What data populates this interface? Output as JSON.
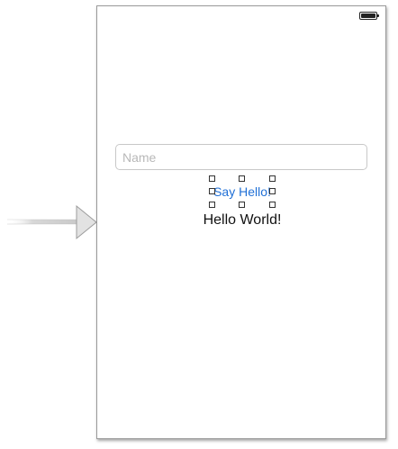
{
  "scene": {
    "entry_arrow_icon": "entry-point-arrow-icon",
    "status_bar": {
      "battery_icon": "battery-icon"
    },
    "name_field": {
      "value": "",
      "placeholder": "Name"
    },
    "say_hello_button": {
      "label": "Say Hello!",
      "selected": true
    },
    "hello_label": {
      "text": "Hello World!"
    }
  },
  "colors": {
    "button_text": "#1f6fd6",
    "frame_border": "#9a9a9a",
    "placeholder": "#b8b8b8"
  }
}
